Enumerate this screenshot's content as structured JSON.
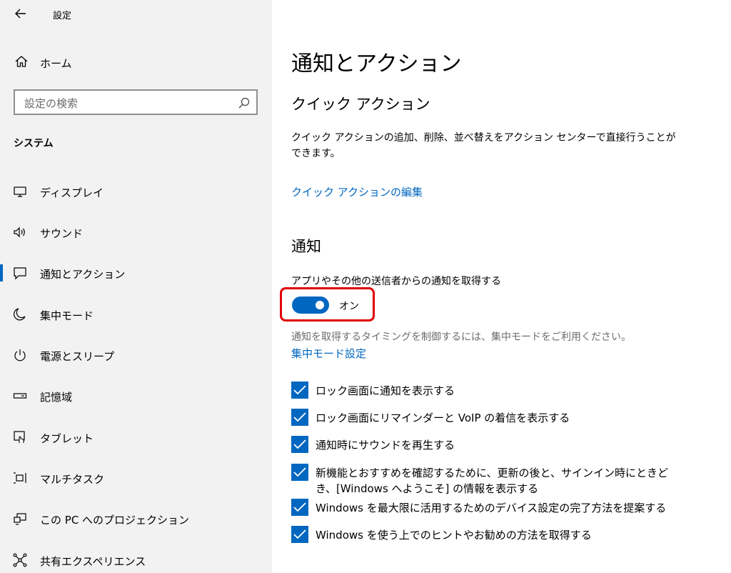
{
  "window": {
    "title": "設定"
  },
  "sidebar": {
    "home_label": "ホーム",
    "search_placeholder": "設定の検索",
    "section_title": "システム",
    "items": [
      {
        "label": "ディスプレイ",
        "icon": "monitor-icon"
      },
      {
        "label": "サウンド",
        "icon": "speaker-icon"
      },
      {
        "label": "通知とアクション",
        "icon": "notification-icon",
        "selected": true
      },
      {
        "label": "集中モード",
        "icon": "moon-icon"
      },
      {
        "label": "電源とスリープ",
        "icon": "power-icon"
      },
      {
        "label": "記憶域",
        "icon": "storage-icon"
      },
      {
        "label": "タブレット",
        "icon": "tablet-icon"
      },
      {
        "label": "マルチタスク",
        "icon": "multitask-icon"
      },
      {
        "label": "この PC へのプロジェクション",
        "icon": "projection-icon"
      },
      {
        "label": "共有エクスペリエンス",
        "icon": "share-icon"
      }
    ]
  },
  "main": {
    "page_title": "通知とアクション",
    "quick_actions": {
      "heading": "クイック アクション",
      "description": "クイック アクションの追加、削除、並べ替えをアクション センターで直接行うことができます。",
      "edit_link": "クイック アクションの編集"
    },
    "notifications": {
      "heading": "通知",
      "toggle_label": "アプリやその他の送信者からの通知を取得する",
      "toggle_state": "オン",
      "toggle_on": true,
      "hint": "通知を取得するタイミングを制御するには、集中モードをご利用ください。",
      "focus_link": "集中モード設定",
      "checkboxes": [
        {
          "label": "ロック画面に通知を表示する",
          "checked": true
        },
        {
          "label": "ロック画面にリマインダーと VoIP の着信を表示する",
          "checked": true
        },
        {
          "label": "通知時にサウンドを再生する",
          "checked": true
        },
        {
          "label": "新機能とおすすめを確認するために、更新の後と、サインイン時にときどき、[Windows へようこそ] の情報を表示する",
          "checked": true
        },
        {
          "label": "Windows を最大限に活用するためのデバイス設定の完了方法を提案する",
          "checked": true
        },
        {
          "label": "Windows を使う上でのヒントやお勧めの方法を取得する",
          "checked": true
        }
      ]
    }
  },
  "colors": {
    "accent": "#0067c0",
    "highlight": "#e00000",
    "sidebar_bg": "#f2f2f2"
  }
}
